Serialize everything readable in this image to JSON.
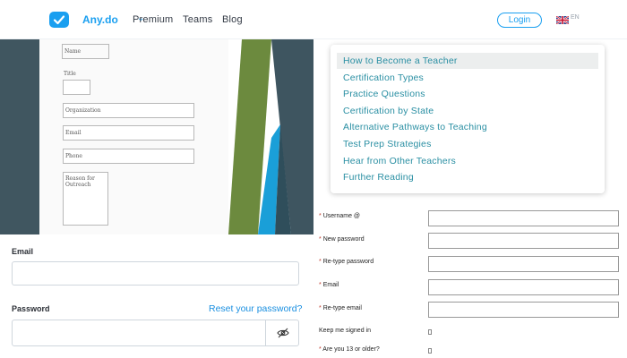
{
  "header": {
    "brand": "Any.do",
    "brand_caret": "⌄",
    "nav": [
      "Premium",
      "Teams",
      "Blog"
    ],
    "login_label": "Login",
    "lang": "EN",
    "logo_color": "#1a9ff0"
  },
  "old_form": {
    "labels": [
      "Name",
      "Title",
      "Organization",
      "Email",
      "Phone",
      "Reason for Outreach"
    ]
  },
  "menu": {
    "items": [
      "How to Become a Teacher",
      "Certification Types",
      "Practice Questions",
      "Certification by State",
      "Alternative Pathways to Teaching",
      "Test Prep Strategies",
      "Hear from Other Teachers",
      "Further Reading"
    ],
    "active_index": 0,
    "link_color": "#2a8fa3"
  },
  "registration": {
    "required_mark": "*",
    "fields": [
      "Username @",
      "New password",
      "Re-type password",
      "Email",
      "Re-type email"
    ],
    "checks": [
      "Keep me signed in",
      "Are you 13 or older?"
    ]
  },
  "login_form": {
    "email_label": "Email",
    "password_label": "Password",
    "reset_link": "Reset your password?",
    "eye_icon": "eye-off-icon"
  }
}
